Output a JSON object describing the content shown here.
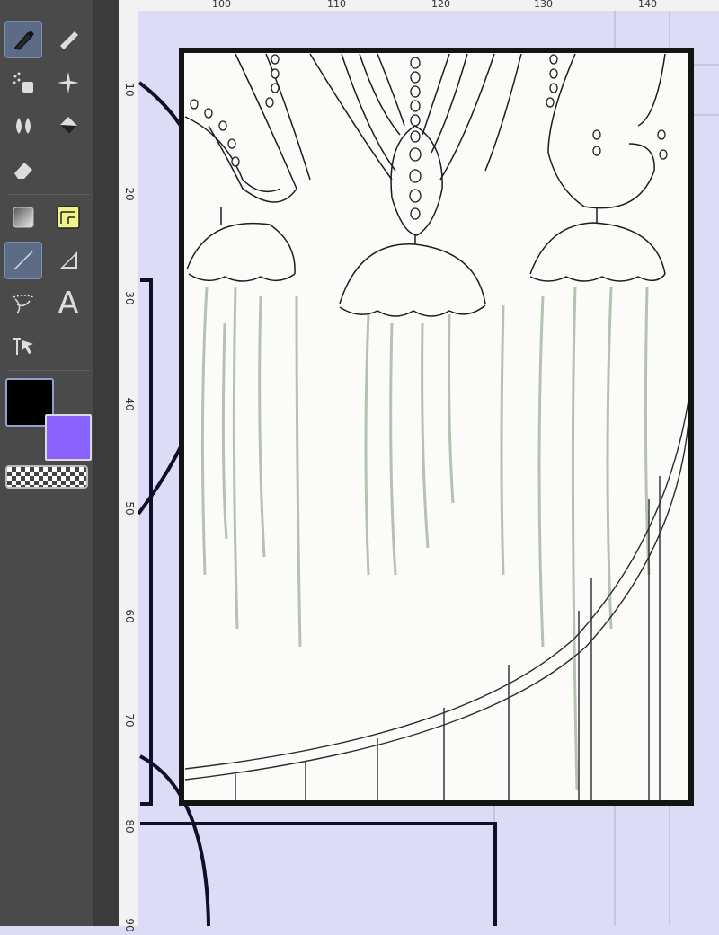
{
  "toolbar": {
    "tools": [
      {
        "name": "pen-tool",
        "icon": "pen-icon",
        "active": true
      },
      {
        "name": "marker-tool",
        "icon": "marker-icon",
        "active": false
      },
      {
        "name": "airbrush-tool",
        "icon": "airbrush-icon",
        "active": false
      },
      {
        "name": "decoration-tool",
        "icon": "sparkle-icon",
        "active": false
      },
      {
        "name": "blend-tool",
        "icon": "blend-drops-icon",
        "active": false
      },
      {
        "name": "fill-tool",
        "icon": "paint-bucket-icon",
        "active": false
      },
      {
        "name": "eraser-tool",
        "icon": "eraser-icon",
        "active": false
      },
      {
        "name": "gradient-tool",
        "icon": "gradient-icon",
        "active": false
      },
      {
        "name": "frame-border-tool",
        "icon": "frame-icon",
        "active": false
      },
      {
        "name": "figure-tool",
        "icon": "line-icon",
        "active": true
      },
      {
        "name": "ruler-tool",
        "icon": "ruler-icon",
        "active": false
      },
      {
        "name": "lasso-tool",
        "icon": "lasso-icon",
        "active": false
      },
      {
        "name": "text-tool",
        "icon": "text-icon",
        "active": false
      },
      {
        "name": "operation-tool",
        "icon": "object-select-icon",
        "active": false
      }
    ],
    "text_tool_glyph": "A",
    "main_color": "#000000",
    "sub_color": "#8a62ff",
    "transparent_color": "checkerboard"
  },
  "rulers": {
    "top_labels": [
      "100",
      "110",
      "120",
      "130",
      "140"
    ],
    "left_labels": [
      "10",
      "20",
      "30",
      "40",
      "50",
      "60",
      "70",
      "80",
      "90"
    ]
  },
  "canvas": {
    "background": "#dcdcf7",
    "panel_fill": "#fbfbf9",
    "border_color": "#141414",
    "sketch_color": "#a9b8a6",
    "frame_color": "#0e0e2e"
  }
}
